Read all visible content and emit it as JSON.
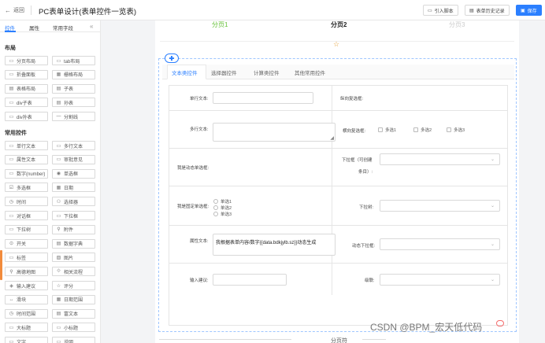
{
  "header": {
    "back_label": "返回",
    "title": "PC表单设计(表单控件一览表)",
    "import_label": "引入脚本",
    "history_label": "表单历史记录",
    "save_label": "保存"
  },
  "left_panel": {
    "tabs": [
      "控件",
      "属性",
      "常用字段"
    ],
    "layout_section": "布局",
    "layout_items": [
      {
        "label": "分页布局",
        "icon": "page-layout-icon"
      },
      {
        "label": "tab布局",
        "icon": "tab-layout-icon"
      },
      {
        "label": "折叠面板",
        "icon": "collapse-panel-icon"
      },
      {
        "label": "栅格布局",
        "icon": "grid-layout-icon"
      },
      {
        "label": "表格布局",
        "icon": "table-layout-icon"
      },
      {
        "label": "子表",
        "icon": "subtable-icon"
      },
      {
        "label": "div子表",
        "icon": "div-subtable-icon"
      },
      {
        "label": "孙表",
        "icon": "grandchild-table-icon"
      },
      {
        "label": "div孙表",
        "icon": "div-grandchild-table-icon"
      },
      {
        "label": "分割线",
        "icon": "divider-icon"
      }
    ],
    "common_section": "常用控件",
    "common_items": [
      {
        "label": "单行文本",
        "icon": "single-line-text-icon"
      },
      {
        "label": "多行文本",
        "icon": "multi-line-text-icon"
      },
      {
        "label": "属性文本",
        "icon": "attribute-text-icon"
      },
      {
        "label": "审批意见",
        "icon": "approval-opinion-icon"
      },
      {
        "label": "数字(number)",
        "icon": "number-icon"
      },
      {
        "label": "单选框",
        "icon": "radio-icon"
      },
      {
        "label": "多选框",
        "icon": "checkbox-icon"
      },
      {
        "label": "日期",
        "icon": "date-icon"
      },
      {
        "label": "时间",
        "icon": "time-icon"
      },
      {
        "label": "选择器",
        "icon": "selector-icon"
      },
      {
        "label": "对话框",
        "icon": "dialog-icon"
      },
      {
        "label": "下拉框",
        "icon": "dropdown-icon"
      },
      {
        "label": "下拉树",
        "icon": "dropdown-tree-icon"
      },
      {
        "label": "附件",
        "icon": "attachment-icon"
      },
      {
        "label": "开关",
        "icon": "switch-icon"
      },
      {
        "label": "数据字典",
        "icon": "data-dictionary-icon"
      },
      {
        "label": "标签",
        "icon": "tag-icon"
      },
      {
        "label": "图片",
        "icon": "image-icon"
      },
      {
        "label": "高德地图",
        "icon": "map-pin-icon"
      },
      {
        "label": "相关流程",
        "icon": "related-process-icon"
      },
      {
        "label": "输入建议",
        "icon": "input-suggestion-icon"
      },
      {
        "label": "评分",
        "icon": "rating-icon"
      },
      {
        "label": "滑块",
        "icon": "slider-icon"
      },
      {
        "label": "日期范围",
        "icon": "date-range-icon"
      },
      {
        "label": "时间范围",
        "icon": "time-range-icon"
      },
      {
        "label": "富文本",
        "icon": "rich-text-icon"
      },
      {
        "label": "大标题",
        "icon": "large-title-icon"
      },
      {
        "label": "小标题",
        "icon": "small-title-icon"
      },
      {
        "label": "文字",
        "icon": "text-icon"
      },
      {
        "label": "说明",
        "icon": "description-icon"
      }
    ]
  },
  "steps": [
    "分页1",
    "分页2",
    "分页3"
  ],
  "form_tabs": [
    "文本类控件",
    "选择器控件",
    "计算类控件",
    "其他常用控件"
  ],
  "form": {
    "single_text_label": "单行文本:",
    "grouped_checkbox_label": "纵向复选框:",
    "multi_text_label": "多行文本:",
    "horizontal_checkbox_label": "横向复选框:",
    "checkbox_options": [
      "多选1",
      "多选2",
      "多选3"
    ],
    "dynamic_radio_label": "我是动态单选框:",
    "dropdown_creatable_label_1": "下拉框（可创建",
    "dropdown_creatable_label_2": "条目）:",
    "fixed_radio_label": "我是固定单选框:",
    "radio_options": [
      "单选1",
      "单选2",
      "单选3"
    ],
    "dropdown_tree_label": "下拉树:",
    "attr_text_label": "属性文本:",
    "attr_text_value": "我根据表单内容/数字{{data.bdkjylb.sz}}动态生成",
    "dynamic_dropdown_label": "动态下拉框:",
    "input_suggest_label": "输入建议:",
    "cascade_label": "级联:"
  },
  "footer": {
    "pager_label": "分页符",
    "watermark": "CSDN @BPM_宏天低代码"
  },
  "colors": {
    "accent": "#2b7fff",
    "step_done": "#67c23a",
    "star": "#e6a23c"
  }
}
